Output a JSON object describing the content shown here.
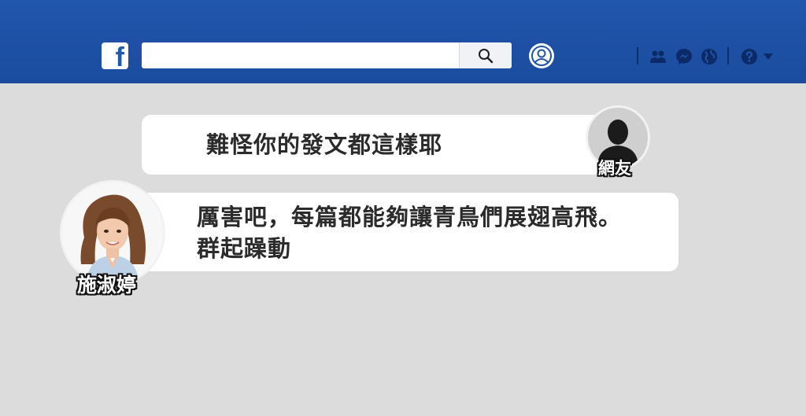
{
  "header": {
    "logo": "f",
    "search": {
      "value": "",
      "placeholder": ""
    },
    "icons": [
      "profile-icon",
      "friends-icon",
      "messenger-icon",
      "globe-icon",
      "help-icon",
      "caret-down-icon"
    ]
  },
  "colors": {
    "topbar": "#1f54a8",
    "background": "#dcdcdc",
    "bubble": "#ffffff",
    "text": "#2b2b2b"
  },
  "messages": [
    {
      "author": "網友",
      "lines": [
        "難怪你的發文都這樣耶"
      ],
      "avatar": "silhouette-icon"
    },
    {
      "author": "施淑婷",
      "lines": [
        "厲害吧，每篇都能夠讓青鳥們展翅高飛。",
        "群起躁動"
      ],
      "avatar": "portrait-photo"
    }
  ]
}
